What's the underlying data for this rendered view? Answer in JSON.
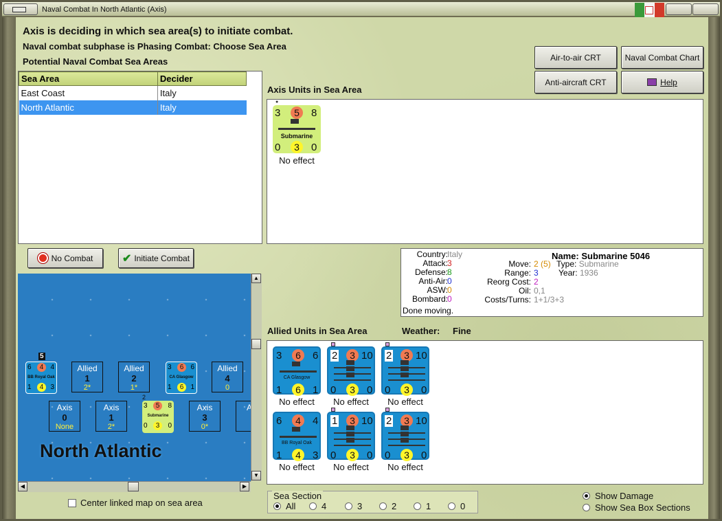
{
  "window": {
    "title": "Naval Combat In North Atlantic (Axis)"
  },
  "headline": "Axis is deciding in which sea area(s) to initiate combat.",
  "subphase": "Naval combat subphase is Phasing Combat: Choose Sea Area",
  "potential": "Potential Naval Combat Sea Areas",
  "buttons": {
    "air_to_air": "Air-to-air CRT",
    "naval_chart": "Naval Combat Chart",
    "anti_aircraft": "Anti-aircraft CRT",
    "help": "Help",
    "no_combat": "No Combat",
    "initiate": "Initiate Combat"
  },
  "sea_table": {
    "headers": [
      "Sea Area",
      "Decider"
    ],
    "rows": [
      [
        "East Coast",
        "Italy"
      ],
      [
        "North Atlantic",
        "Italy"
      ]
    ]
  },
  "axis_units_label": "Axis Units in Sea Area",
  "axis_units": [
    {
      "name": "Submarine",
      "top": [
        "3",
        "5",
        "8"
      ],
      "bottom": [
        "0",
        "3",
        "0"
      ],
      "effect": "No effect",
      "badge": "●"
    }
  ],
  "unit_info": {
    "country_k": "Country:",
    "country_v": "Italy",
    "attack_k": "Attack:",
    "attack_v": "3",
    "defense_k": "Defense:",
    "defense_v": "8",
    "aa_k": "Anti-Air:",
    "aa_v": "0",
    "asw_k": "ASW:",
    "asw_v": "0",
    "bombard_k": "Bombard:",
    "bombard_v": "0",
    "done": "Done moving.",
    "name": "Name: Submarine 5046",
    "move_k": "Move:",
    "move_v": "2",
    "move_v2": "(5)",
    "type_k": "Type:",
    "type_v": "Submarine",
    "range_k": "Range:",
    "range_v": "3",
    "year_k": "Year:",
    "year_v": "1936",
    "reorg_k": "Reorg Cost:",
    "reorg_v": "2",
    "oil_k": "Oil:",
    "oil_v": "0,1",
    "costs_k": "Costs/Turns:",
    "costs_v": "1+1/3+3"
  },
  "allied_label": "Allied Units in Sea Area",
  "weather_label": "Weather:",
  "weather": "Fine",
  "allied_units": [
    {
      "name": "CA Glasgow",
      "top": [
        "3",
        "6",
        "6"
      ],
      "bottom": [
        "1",
        "6",
        "1"
      ],
      "effect": "No effect"
    },
    {
      "name": "",
      "top": [
        "2",
        "3",
        "10"
      ],
      "bottom": [
        "0",
        "3",
        "0"
      ],
      "effect": "No effect"
    },
    {
      "name": "",
      "top": [
        "2",
        "3",
        "10"
      ],
      "bottom": [
        "0",
        "3",
        "0"
      ],
      "effect": "No effect"
    },
    {
      "name": "BB Royal Oak",
      "top": [
        "6",
        "4",
        "4"
      ],
      "bottom": [
        "1",
        "4",
        "3"
      ],
      "effect": "No effect"
    },
    {
      "name": "",
      "top": [
        "1",
        "3",
        "10"
      ],
      "bottom": [
        "0",
        "3",
        "0"
      ],
      "effect": "No effect"
    },
    {
      "name": "",
      "top": [
        "2",
        "3",
        "10"
      ],
      "bottom": [
        "0",
        "3",
        "0"
      ],
      "effect": "No effect"
    }
  ],
  "map": {
    "name": "North Atlantic",
    "badge": "5",
    "badge2": "2",
    "top_row": [
      {
        "kind": "counter",
        "name": "BB Royal Oak",
        "t": [
          "6",
          "4",
          "4"
        ],
        "b": [
          "1",
          "4",
          "3"
        ]
      },
      {
        "kind": "box",
        "t": "Allied",
        "n": "1",
        "y": "2*"
      },
      {
        "kind": "box",
        "t": "Allied",
        "n": "2",
        "y": "1*"
      },
      {
        "kind": "counter",
        "name": "CA Glasgow",
        "t": [
          "3",
          "6",
          "6"
        ],
        "b": [
          "1",
          "6",
          "1"
        ]
      },
      {
        "kind": "box",
        "t": "Allied",
        "n": "4",
        "y": "0"
      }
    ],
    "bottom_row": [
      {
        "kind": "box",
        "t": "Axis",
        "n": "0",
        "y": "None"
      },
      {
        "kind": "box",
        "t": "Axis",
        "n": "1",
        "y": "2*"
      },
      {
        "kind": "counter",
        "name": "Submarine",
        "t": [
          "3",
          "5",
          "8"
        ],
        "b": [
          "0",
          "3",
          "0"
        ]
      },
      {
        "kind": "box",
        "t": "Axis",
        "n": "3",
        "y": "0*"
      },
      {
        "kind": "box",
        "t": "Ax",
        "n": "",
        "y": ""
      }
    ]
  },
  "center_map": "Center linked map on sea area",
  "sea_section": {
    "label": "Sea Section",
    "options": [
      "All",
      "4",
      "3",
      "2",
      "1",
      "0"
    ]
  },
  "show_damage": "Show Damage",
  "show_sections": "Show Sea Box Sections"
}
